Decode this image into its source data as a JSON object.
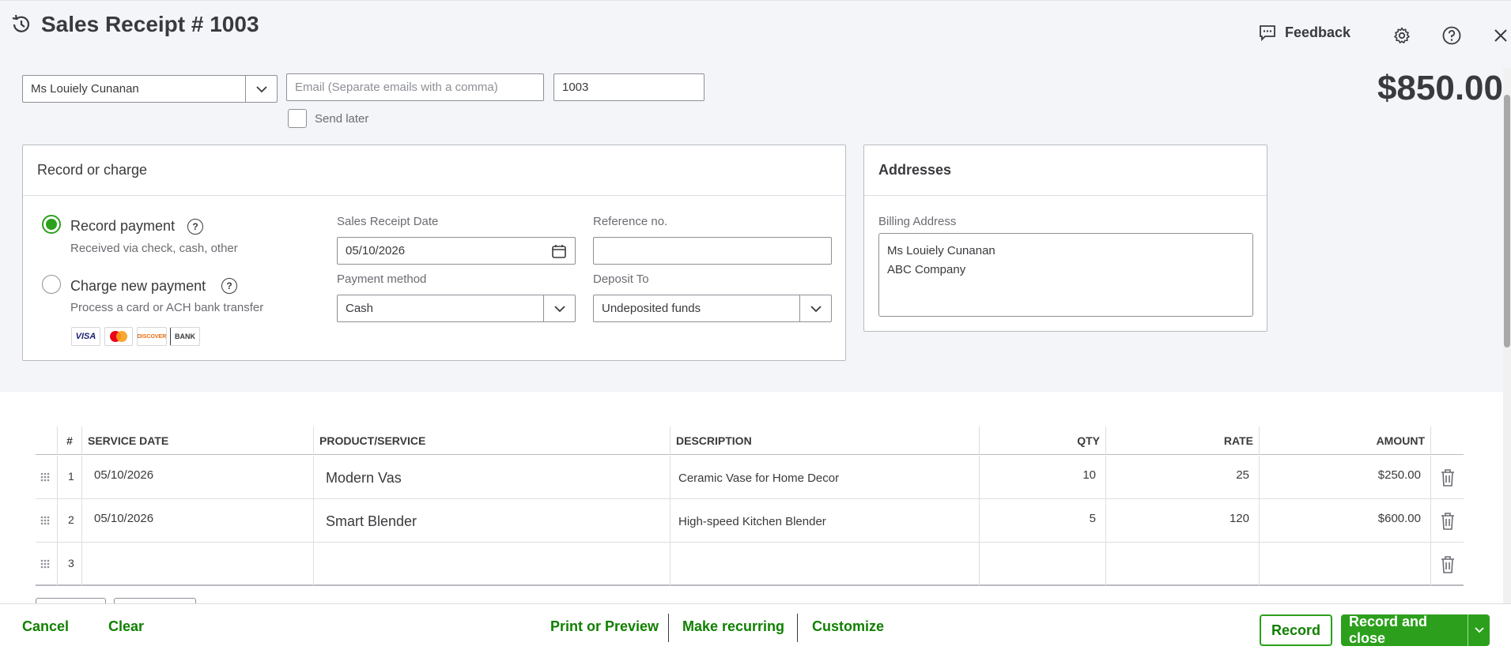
{
  "header": {
    "title": "Sales Receipt # 1003",
    "feedback_label": "Feedback"
  },
  "customer": {
    "name": "Ms Louiely Cunanan",
    "email_placeholder": "Email (Separate emails with a comma)",
    "receipt_no": "1003",
    "send_later_label": "Send later"
  },
  "total": "$850.00",
  "record_or_charge": {
    "heading": "Record or charge",
    "options": [
      {
        "label": "Record payment",
        "sub": "Received via check, cash, other",
        "selected": true
      },
      {
        "label": "Charge new payment",
        "sub": "Process a card or ACH bank transfer",
        "selected": false
      }
    ],
    "card_logos": [
      "VISA",
      "DISCOVER",
      "BANK"
    ],
    "date_label": "Sales Receipt Date",
    "date_value": "05/10/2026",
    "ref_label": "Reference no.",
    "ref_value": "",
    "method_label": "Payment method",
    "method_value": "Cash",
    "deposit_label": "Deposit To",
    "deposit_value": "Undeposited funds"
  },
  "addresses": {
    "heading": "Addresses",
    "billing_label": "Billing Address",
    "billing_lines": [
      "Ms Louiely Cunanan",
      "ABC Company"
    ]
  },
  "table": {
    "columns": [
      "#",
      "SERVICE DATE",
      "PRODUCT/SERVICE",
      "DESCRIPTION",
      "QTY",
      "RATE",
      "AMOUNT"
    ],
    "rows": [
      {
        "num": "1",
        "date": "05/10/2026",
        "product": "Modern Vas",
        "description": "Ceramic Vase for Home Decor",
        "qty": "10",
        "rate": "25",
        "amount": "$250.00"
      },
      {
        "num": "2",
        "date": "05/10/2026",
        "product": "Smart Blender",
        "description": "High-speed Kitchen Blender",
        "qty": "5",
        "rate": "120",
        "amount": "$600.00"
      },
      {
        "num": "3",
        "date": "",
        "product": "",
        "description": "",
        "qty": "",
        "rate": "",
        "amount": ""
      }
    ]
  },
  "footer": {
    "cancel": "Cancel",
    "clear": "Clear",
    "print_preview": "Print or Preview",
    "make_recurring": "Make recurring",
    "customize": "Customize",
    "record": "Record",
    "record_close": "Record and close"
  },
  "colors": {
    "brand_green": "#2ca01c",
    "link_green": "#108000",
    "background": "#f4f5f8"
  }
}
